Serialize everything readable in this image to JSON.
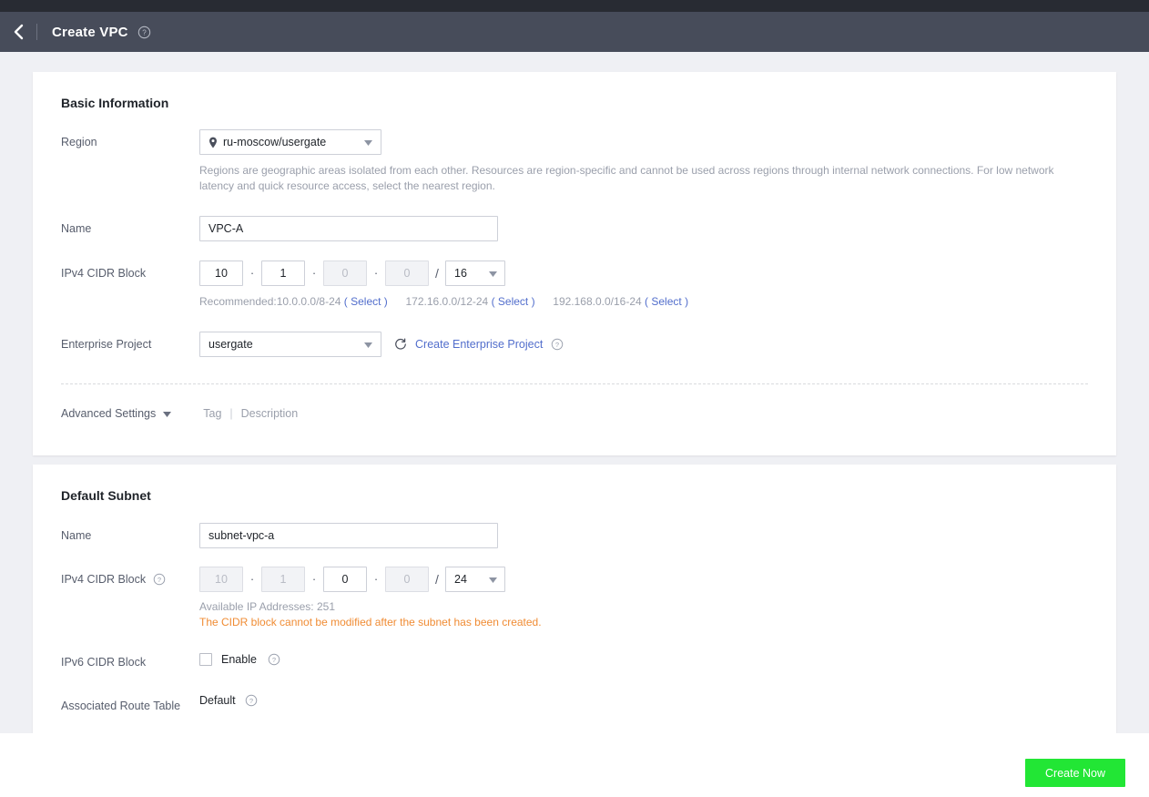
{
  "header": {
    "title": "Create VPC",
    "back_icon": "chevron-left-icon",
    "help_icon": "question-circle-icon"
  },
  "basic": {
    "section_title": "Basic Information",
    "region": {
      "label": "Region",
      "value": "ru-moscow/usergate",
      "icon": "location-pin-icon",
      "hint": "Regions are geographic areas isolated from each other. Resources are region-specific and cannot be used across regions through internal network connections. For low network latency and quick resource access, select the nearest region."
    },
    "name": {
      "label": "Name",
      "value": "VPC-A"
    },
    "cidr": {
      "label": "IPv4 CIDR Block",
      "octet1": "10",
      "octet2": "1",
      "octet3": "0",
      "octet4": "0",
      "mask": "16",
      "recommend_prefix": "Recommended:10.0.0.0/8-24",
      "recommend_select1": "( Select )",
      "recommend_2": "172.16.0.0/12-24",
      "recommend_select2": "( Select )",
      "recommend_3": "192.168.0.0/16-24",
      "recommend_select3": "( Select )"
    },
    "enterprise": {
      "label": "Enterprise Project",
      "value": "usergate",
      "refresh_icon": "refresh-icon",
      "create_link": "Create Enterprise Project",
      "help_icon": "question-circle-icon"
    },
    "advanced": {
      "label": "Advanced Settings",
      "caret_icon": "chevron-down-icon",
      "tab_tag": "Tag",
      "separator": "|",
      "tab_description": "Description"
    }
  },
  "subnet": {
    "section_title": "Default Subnet",
    "name": {
      "label": "Name",
      "value": "subnet-vpc-a"
    },
    "cidr": {
      "label": "IPv4 CIDR Block",
      "help_icon": "question-circle-icon",
      "octet1": "10",
      "octet2": "1",
      "octet3": "0",
      "octet4": "0",
      "mask": "24",
      "available": "Available IP Addresses: 251",
      "warning": "The CIDR block cannot be modified after the subnet has been created."
    },
    "ipv6": {
      "label": "IPv6 CIDR Block",
      "checkbox_label": "Enable",
      "checked": false,
      "help_icon": "question-circle-icon"
    },
    "route_table": {
      "label": "Associated Route Table",
      "value": "Default",
      "help_icon": "question-circle-icon"
    }
  },
  "footer": {
    "create_button": "Create Now"
  },
  "colors": {
    "header_bg": "#474c5a",
    "topbar_bg": "#282b33",
    "page_bg": "#eff0f4",
    "link": "#526ecc",
    "warning": "#f08c34",
    "primary_button": "#22e635"
  }
}
